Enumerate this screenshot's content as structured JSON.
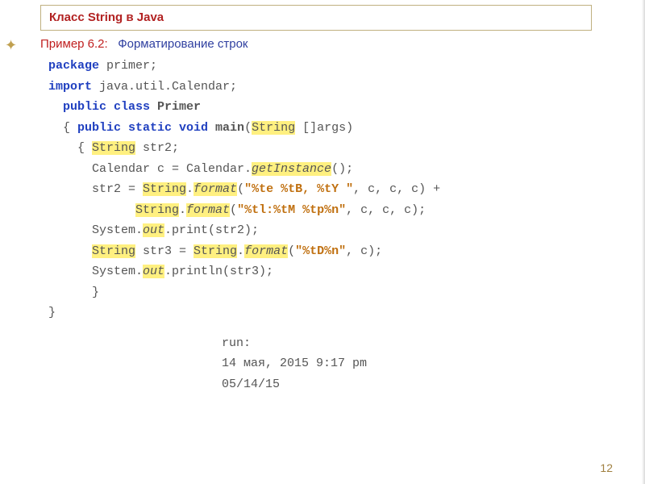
{
  "header": {
    "title": "Класс String в Java"
  },
  "example": {
    "prefix": "Пример 6.2:",
    "text": "Форматирование строк"
  },
  "code": {
    "l1_package": "package",
    "l1_pkgname": " primer;",
    "l2_import": "import",
    "l2_path": " java.util.Calendar;",
    "l3_pub": "public class ",
    "l3_cls": "Primer",
    "l4_open": "{ ",
    "l4_sig": "public static void ",
    "l4_main": "main",
    "l4_par1": "(",
    "l4_string": "String",
    "l4_par2": " []args)",
    "l5": "{ ",
    "l5_string": "String",
    "l5_rest": " str2;",
    "l6": "Calendar c = Calendar.",
    "l6_get": "getInstance",
    "l6_end": "();",
    "l7a": "str2 = ",
    "l7b": "String",
    "l7c": ".",
    "l7_fmt": "format",
    "l7d": "(",
    "l7_s1": "\"%te %tB, %tY \"",
    "l7e": ", c, c, c) +",
    "l8b": "String",
    "l8_fmt": "format",
    "l8_s": "\"%tl:%tM %tp%n\"",
    "l8e": ", c, c, c);",
    "l9a": "System.",
    "l9_out": "out",
    "l9b": ".print(str2);",
    "l10a": "String",
    "l10b": " str3 = ",
    "l10c": "String",
    "l10_fmt": "format",
    "l10_s": "\"%tD%n\"",
    "l10e": ", c);",
    "l11a": "System.",
    "l11_out": "out",
    "l11b": ".println(str3);",
    "l12": "}",
    "l13": "}"
  },
  "output": {
    "run": "run:",
    "line1": "14 мая, 2015 9:17 pm",
    "line2": "05/14/15"
  },
  "page": "12"
}
